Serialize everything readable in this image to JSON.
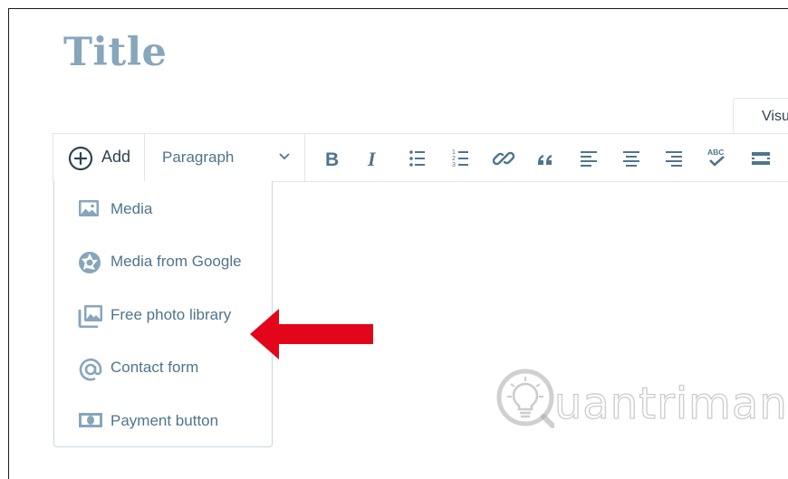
{
  "page": {
    "title": "Title"
  },
  "tabs": [
    {
      "label": "Visual",
      "visible_label": "Visu"
    }
  ],
  "toolbar": {
    "add_label": "Add",
    "format_select": {
      "value": "Paragraph"
    },
    "buttons": [
      {
        "name": "bold-button",
        "icon": "bold-icon"
      },
      {
        "name": "italic-button",
        "icon": "italic-icon"
      },
      {
        "name": "bullet-list-button",
        "icon": "bullet-list-icon"
      },
      {
        "name": "numbered-list-button",
        "icon": "numbered-list-icon"
      },
      {
        "name": "link-button",
        "icon": "link-icon"
      },
      {
        "name": "blockquote-button",
        "icon": "blockquote-icon"
      },
      {
        "name": "align-left-button",
        "icon": "align-left-icon"
      },
      {
        "name": "align-center-button",
        "icon": "align-center-icon"
      },
      {
        "name": "align-right-button",
        "icon": "align-right-icon"
      },
      {
        "name": "spellcheck-button",
        "icon": "spellcheck-icon",
        "icon_text": "ABC"
      },
      {
        "name": "more-button",
        "icon": "read-more-icon"
      }
    ]
  },
  "add_menu": {
    "items": [
      {
        "label": "Media",
        "icon": "image-icon"
      },
      {
        "label": "Media from Google",
        "icon": "camera-aperture-icon"
      },
      {
        "label": "Free photo library",
        "icon": "photo-library-icon"
      },
      {
        "label": "Contact form",
        "icon": "at-sign-icon"
      },
      {
        "label": "Payment button",
        "icon": "money-icon"
      }
    ]
  },
  "annotation": {
    "icon": "red-arrow-icon",
    "color": "#e3061b",
    "points_to": "Free photo library"
  },
  "watermark": {
    "text": "uantrimang",
    "icon": "lightbulb-logo-icon"
  },
  "colors": {
    "title": "#87a6bc",
    "text": "#2e4453",
    "menu_text": "#4f748e",
    "border": "#e1e6ea",
    "icon": "#87a6bc"
  }
}
